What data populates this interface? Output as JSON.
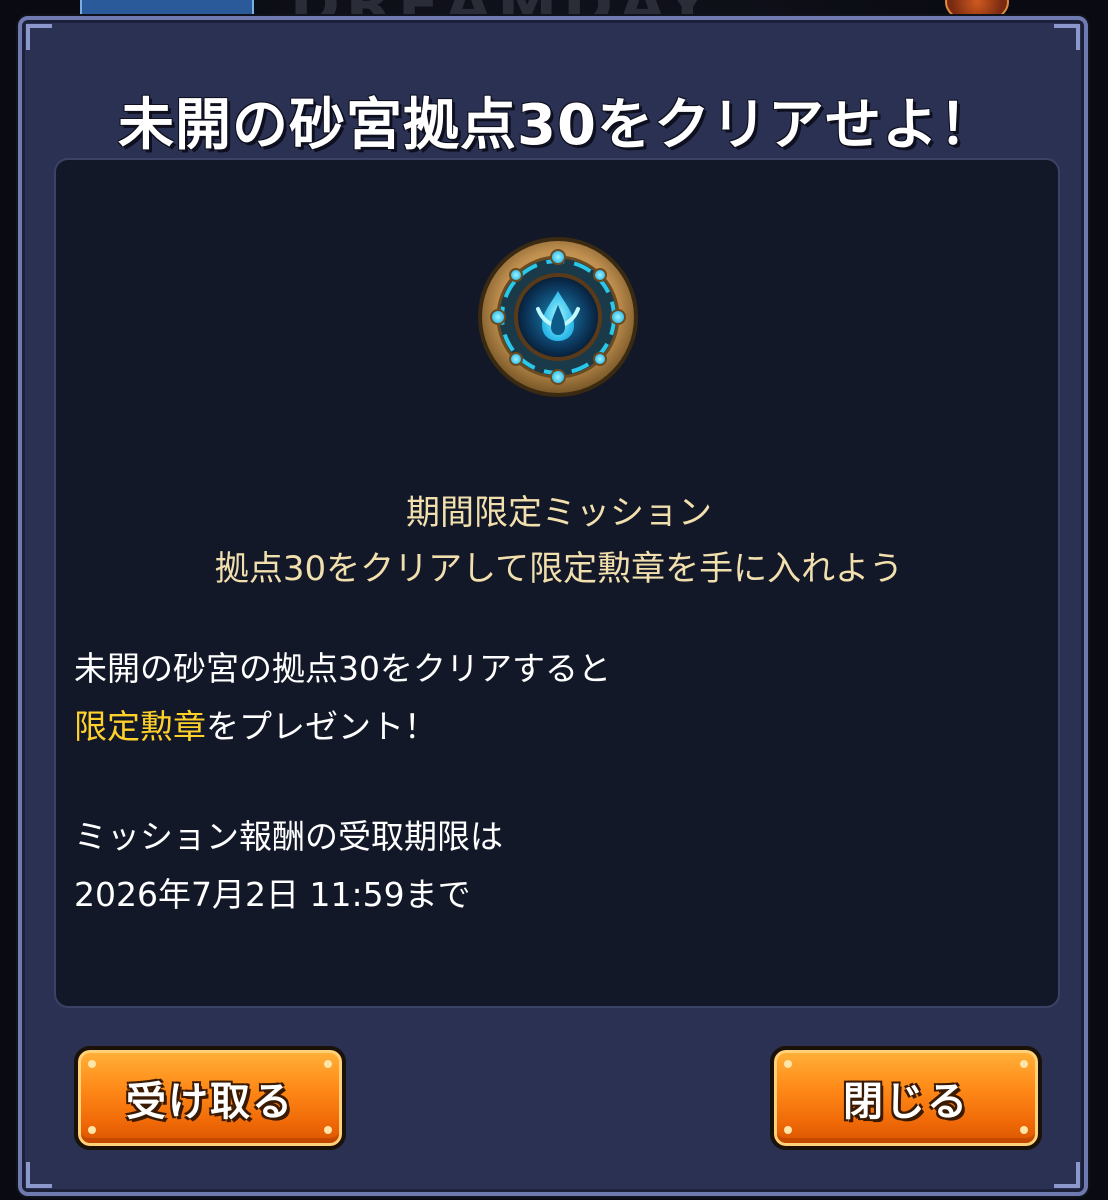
{
  "dialog": {
    "title": "未開の砂宮拠点30をクリアせよ！",
    "medal_icon": "water-drop-medal-icon",
    "sub_heading": {
      "line1": "期間限定ミッション",
      "line2": "拠点30をクリアして限定勲章を手に入れよう"
    },
    "body": {
      "line1": "未開の砂宮の拠点30をクリアすると",
      "line2_highlight": "限定勲章",
      "line2_rest": "をプレゼント！",
      "line3": "ミッション報酬の受取期限は",
      "line4": "2026年7月2日 11:59まで"
    },
    "buttons": {
      "receive_label": "受け取る",
      "close_label": "閉じる"
    }
  },
  "colors": {
    "panel_bg": "#2b3152",
    "content_bg": "#131828",
    "sub_heading_text": "#f2dfae",
    "highlight_text": "#ffd12a",
    "button_orange": "#ff8a18"
  }
}
